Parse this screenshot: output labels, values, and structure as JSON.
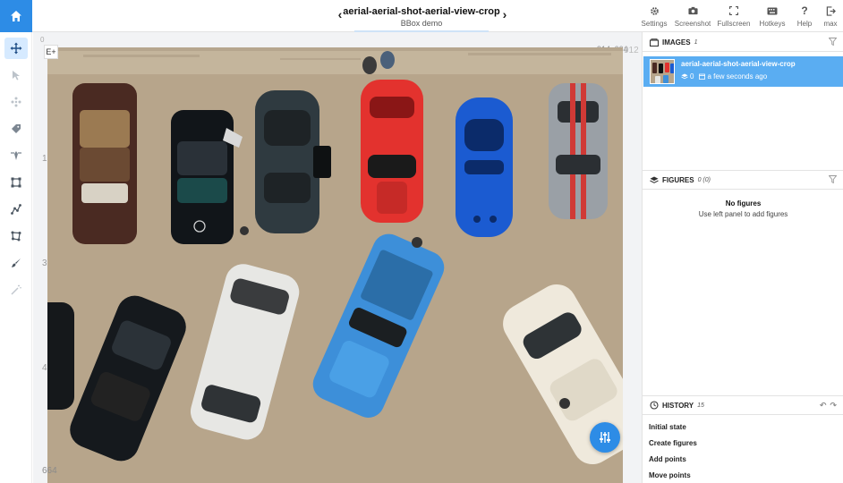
{
  "header": {
    "title": "aerial-aerial-shot-aerial-view-crop",
    "subtitle": "BBox demo",
    "prev_label": "‹",
    "next_label": "›"
  },
  "toolbar": {
    "items": [
      {
        "label": "Settings",
        "icon": "gear-icon"
      },
      {
        "label": "Screenshot",
        "icon": "camera-icon"
      },
      {
        "label": "Fullscreen",
        "icon": "fullscreen-icon"
      },
      {
        "label": "Hotkeys",
        "icon": "keyboard-icon"
      },
      {
        "label": "Help",
        "icon": "help-icon"
      },
      {
        "label": "max",
        "icon": "logout-icon"
      }
    ]
  },
  "left_tools": [
    {
      "name": "move-tool",
      "icon": "move-icon",
      "active": true
    },
    {
      "name": "select-tool",
      "icon": "cursor-icon"
    },
    {
      "name": "drag-tool",
      "icon": "drag-icon"
    },
    {
      "name": "tag-tool",
      "icon": "tag-icon"
    },
    {
      "name": "point-tool",
      "icon": "point-icon"
    },
    {
      "name": "bbox-tool",
      "icon": "bbox-icon"
    },
    {
      "name": "polyline-tool",
      "icon": "polyline-icon"
    },
    {
      "name": "polygon-tool",
      "icon": "polygon-icon"
    },
    {
      "name": "brush-tool",
      "icon": "brush-icon"
    },
    {
      "name": "magic-tool",
      "icon": "magic-wand-icon"
    }
  ],
  "canvas": {
    "dimensions_label": "914x664",
    "top_left_mark": "0",
    "ruler_top_right": "912",
    "ruler": [
      "1",
      "3",
      "4"
    ],
    "bottom_left_label": "664",
    "zoom_label": "E+"
  },
  "images_panel": {
    "title": "IMAGES",
    "count": "1",
    "items": [
      {
        "name": "aerial-aerial-shot-aerial-view-crop",
        "figures": "0",
        "time": "a few seconds ago"
      }
    ]
  },
  "figures_panel": {
    "title": "FIGURES",
    "count": "0 (0)",
    "empty_title": "No figures",
    "empty_subtitle": "Use left panel to add figures"
  },
  "history_panel": {
    "title": "HISTORY",
    "count": "15",
    "items": [
      "Initial state",
      "Create figures",
      "Add points",
      "Move points"
    ]
  },
  "colors": {
    "accent": "#2d8ce6",
    "selected_row": "#5aadf2",
    "ground": "#b5a38a"
  }
}
